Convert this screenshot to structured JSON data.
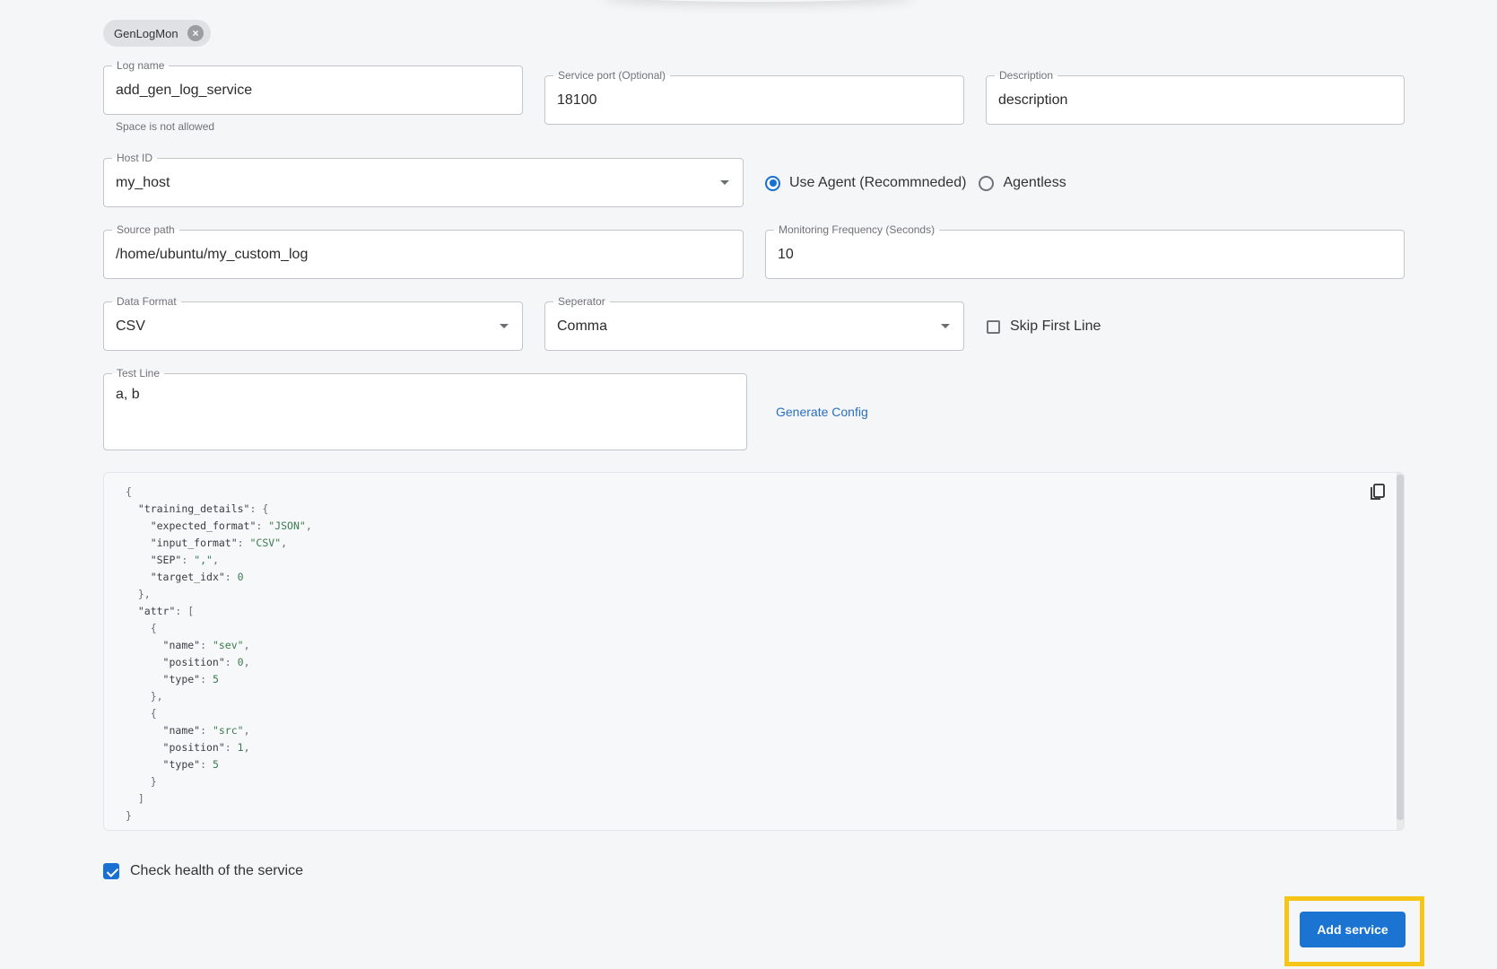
{
  "chip": {
    "label": "GenLogMon",
    "close_icon": "close-circle-icon"
  },
  "fields": {
    "log_name": {
      "label": "Log name",
      "value": "add_gen_log_service",
      "helper": "Space is not allowed"
    },
    "service_port": {
      "label": "Service port (Optional)",
      "value": "18100"
    },
    "description": {
      "label": "Description",
      "value": "description"
    },
    "host_id": {
      "label": "Host ID",
      "value": "my_host"
    },
    "source_path": {
      "label": "Source path",
      "value": "/home/ubuntu/my_custom_log"
    },
    "monitoring_frequency": {
      "label": "Monitoring Frequency (Seconds)",
      "value": "10"
    },
    "data_format": {
      "label": "Data Format",
      "value": "CSV"
    },
    "separator": {
      "label": "Seperator",
      "value": "Comma"
    },
    "test_line": {
      "label": "Test Line",
      "value": "a, b"
    }
  },
  "agent_mode": {
    "options": [
      {
        "label": "Use Agent (Recommneded)",
        "checked": true
      },
      {
        "label": "Agentless",
        "checked": false
      }
    ]
  },
  "skip_first_line": {
    "label": "Skip First Line",
    "checked": false
  },
  "generate_config": {
    "label": "Generate Config"
  },
  "config_json": {
    "lines": [
      [
        [
          "p",
          "{"
        ]
      ],
      [
        [
          "p",
          "  "
        ],
        [
          "k",
          "\"training_details\""
        ],
        [
          "p",
          ": {"
        ]
      ],
      [
        [
          "p",
          "    "
        ],
        [
          "k",
          "\"expected_format\""
        ],
        [
          "p",
          ": "
        ],
        [
          "s",
          "\"JSON\""
        ],
        [
          "p",
          ","
        ]
      ],
      [
        [
          "p",
          "    "
        ],
        [
          "k",
          "\"input_format\""
        ],
        [
          "p",
          ": "
        ],
        [
          "s",
          "\"CSV\""
        ],
        [
          "p",
          ","
        ]
      ],
      [
        [
          "p",
          "    "
        ],
        [
          "k",
          "\"SEP\""
        ],
        [
          "p",
          ": "
        ],
        [
          "s",
          "\",\""
        ],
        [
          "p",
          ","
        ]
      ],
      [
        [
          "p",
          "    "
        ],
        [
          "k",
          "\"target_idx\""
        ],
        [
          "p",
          ": "
        ],
        [
          "n",
          "0"
        ]
      ],
      [
        [
          "p",
          "  },"
        ]
      ],
      [
        [
          "p",
          "  "
        ],
        [
          "k",
          "\"attr\""
        ],
        [
          "p",
          ": ["
        ]
      ],
      [
        [
          "p",
          "    {"
        ]
      ],
      [
        [
          "p",
          "      "
        ],
        [
          "k",
          "\"name\""
        ],
        [
          "p",
          ": "
        ],
        [
          "s",
          "\"sev\""
        ],
        [
          "p",
          ","
        ]
      ],
      [
        [
          "p",
          "      "
        ],
        [
          "k",
          "\"position\""
        ],
        [
          "p",
          ": "
        ],
        [
          "n",
          "0"
        ],
        [
          "p",
          ","
        ]
      ],
      [
        [
          "p",
          "      "
        ],
        [
          "k",
          "\"type\""
        ],
        [
          "p",
          ": "
        ],
        [
          "n",
          "5"
        ]
      ],
      [
        [
          "p",
          "    },"
        ]
      ],
      [
        [
          "p",
          "    {"
        ]
      ],
      [
        [
          "p",
          "      "
        ],
        [
          "k",
          "\"name\""
        ],
        [
          "p",
          ": "
        ],
        [
          "s",
          "\"src\""
        ],
        [
          "p",
          ","
        ]
      ],
      [
        [
          "p",
          "      "
        ],
        [
          "k",
          "\"position\""
        ],
        [
          "p",
          ": "
        ],
        [
          "n",
          "1"
        ],
        [
          "p",
          ","
        ]
      ],
      [
        [
          "p",
          "      "
        ],
        [
          "k",
          "\"type\""
        ],
        [
          "p",
          ": "
        ],
        [
          "n",
          "5"
        ]
      ],
      [
        [
          "p",
          "    }"
        ]
      ],
      [
        [
          "p",
          "  ]"
        ]
      ],
      [
        [
          "p",
          "}"
        ]
      ]
    ],
    "copy_icon": "copy-icon"
  },
  "check_health": {
    "label": "Check health of the service",
    "checked": true
  },
  "add_service": {
    "label": "Add service"
  },
  "colors": {
    "accent": "#1b74d2",
    "highlight": "#f5c518",
    "link": "#2a6fbf",
    "json_value": "#3b7a4f"
  }
}
